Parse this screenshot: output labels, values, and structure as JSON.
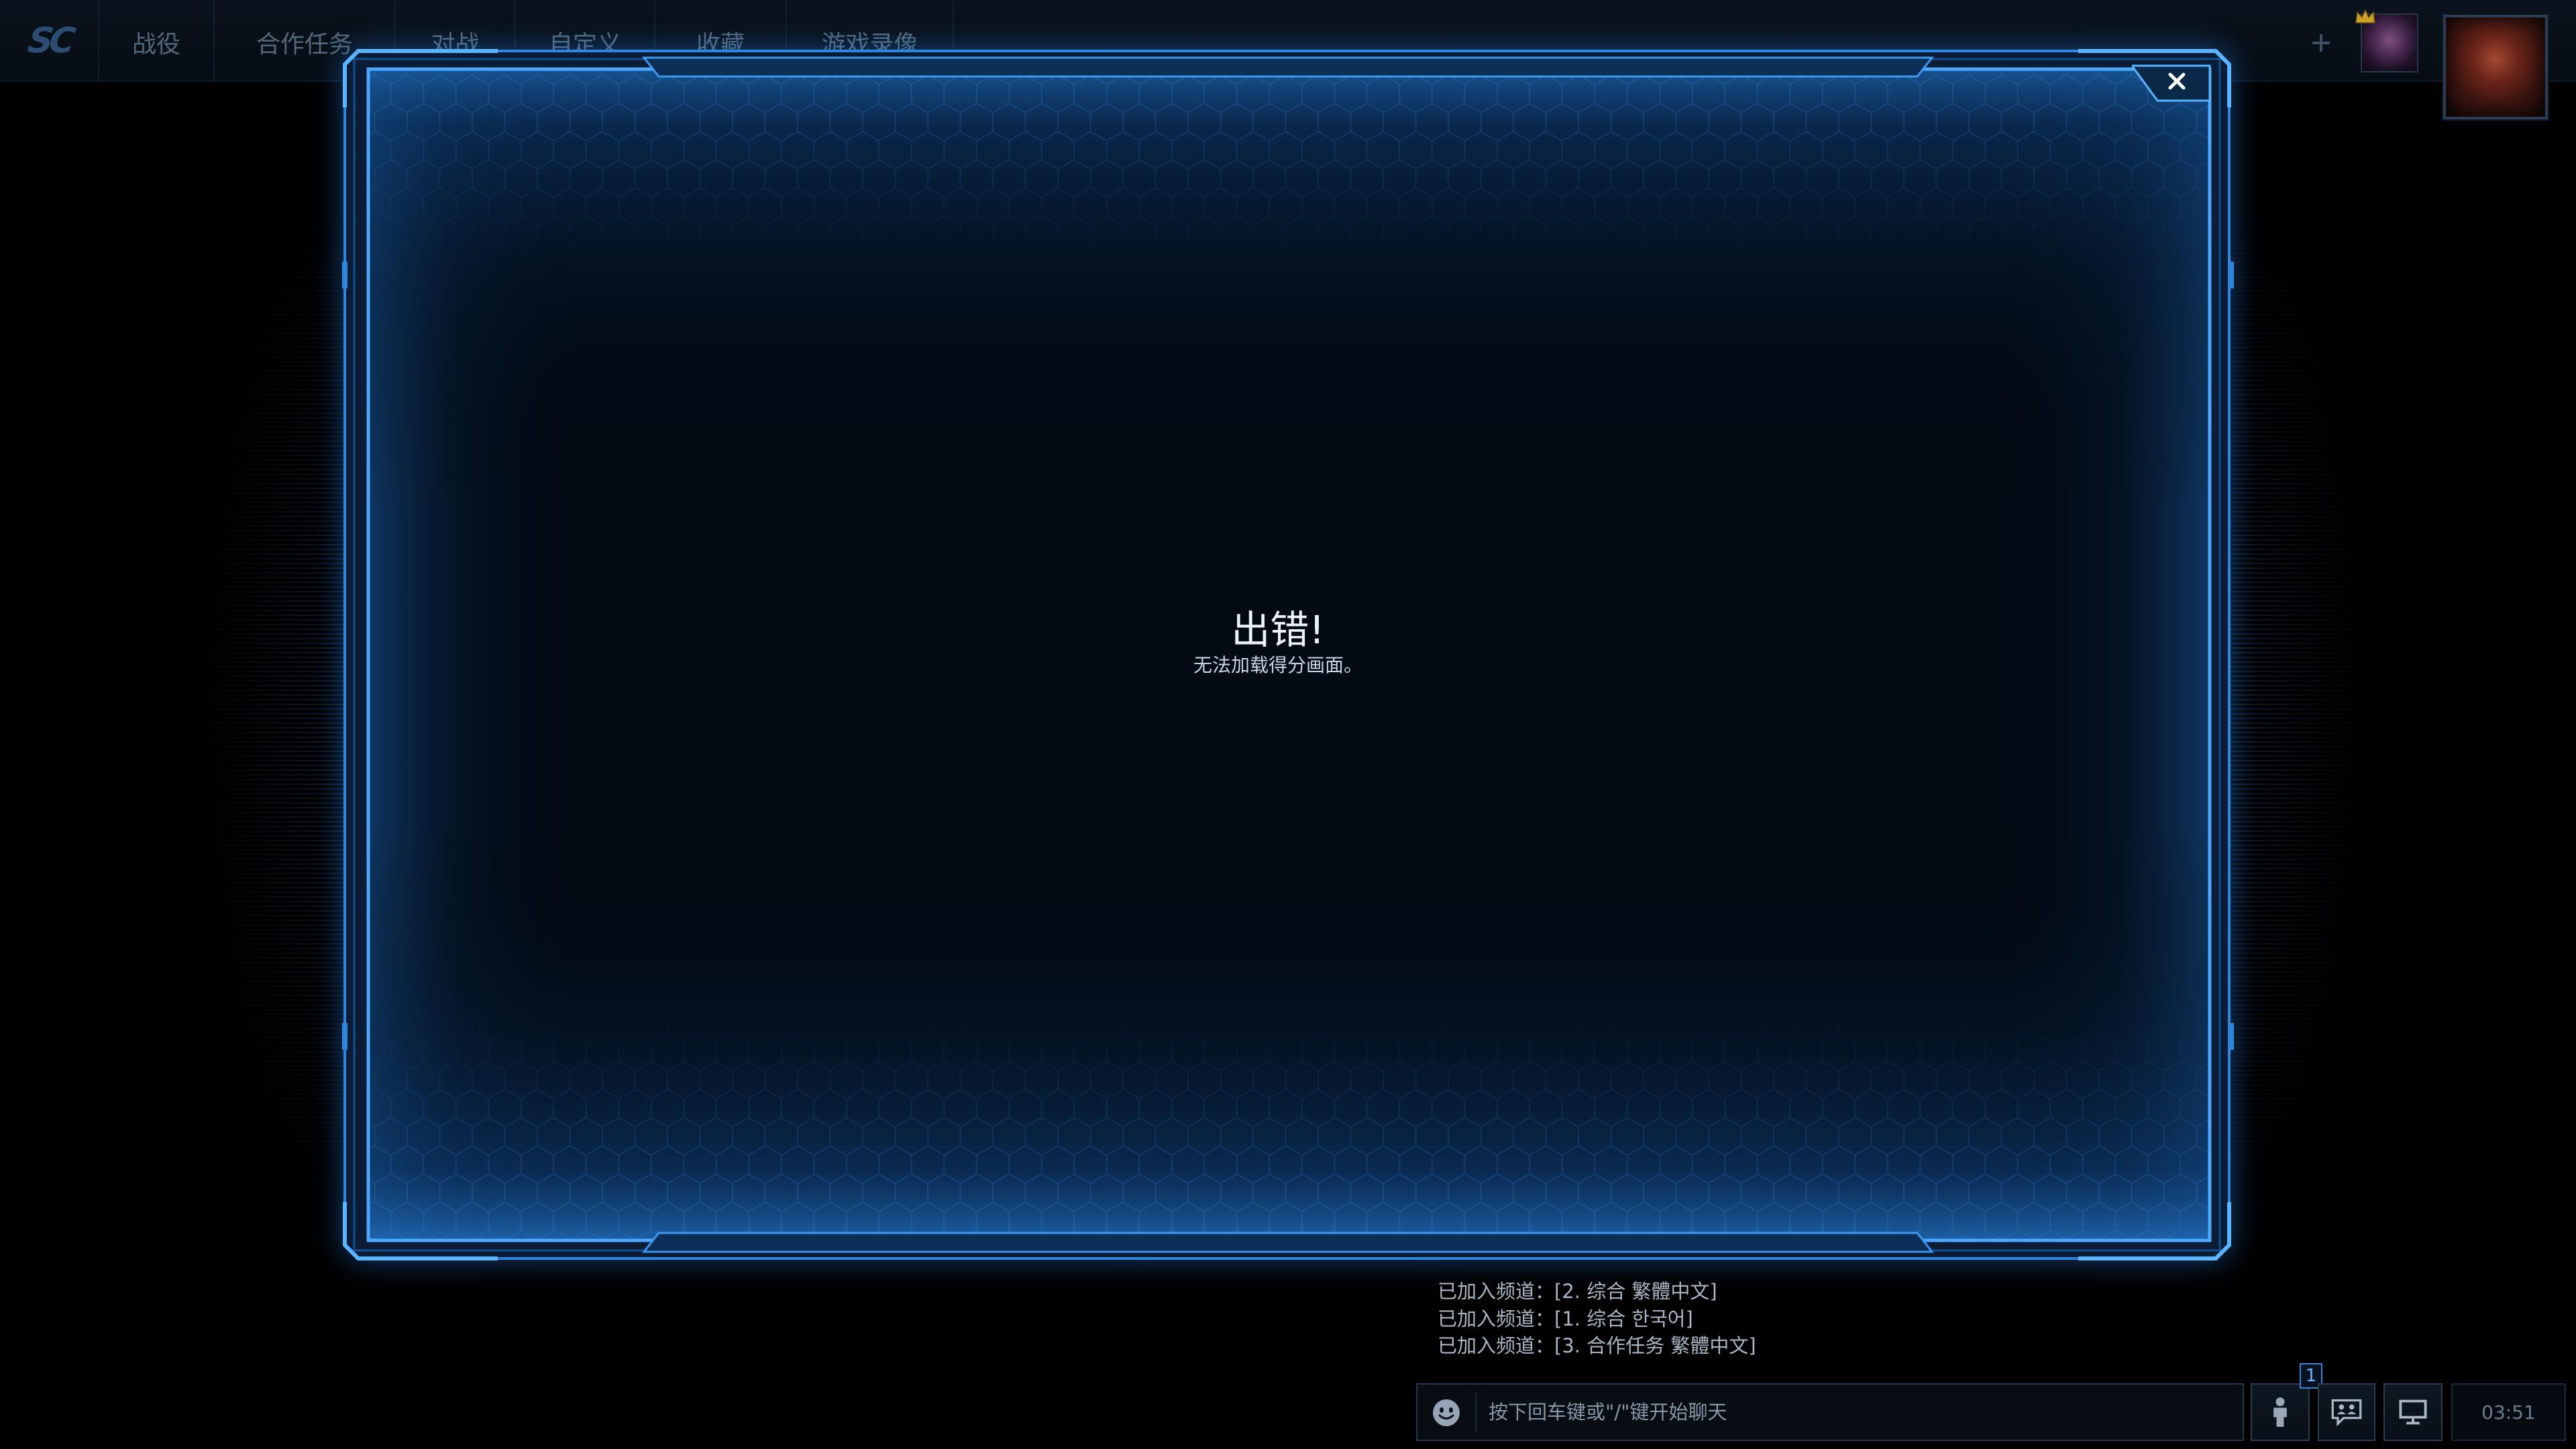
{
  "nav": {
    "logo_text": "SC",
    "items": [
      {
        "label": "战役"
      },
      {
        "label": "合作任务"
      },
      {
        "label": "对战"
      },
      {
        "label": "自定义"
      },
      {
        "label": "收藏"
      },
      {
        "label": "游戏录像"
      }
    ],
    "add_icon": "plus-icon",
    "crown_icon": "crown-icon"
  },
  "dialog": {
    "title": "出错!",
    "message": "无法加载得分画面。",
    "close_icon": "close-icon"
  },
  "chat": {
    "messages": [
      "已加入频道：[2. 综合 繁體中文]",
      "已加入频道：[1. 综合 한국어]",
      "已加入频道：[3. 合作任务 繁體中文]"
    ],
    "input_placeholder": "按下回车键或\"/\"键开始聊天",
    "emoji_icon": "smiley-icon"
  },
  "footer": {
    "friends_icon": "person-icon",
    "friends_badge": "1",
    "chat_icon": "chat-icon",
    "monitor_icon": "monitor-icon",
    "clock": "03:51"
  },
  "colors": {
    "frame_accent": "#4ca8ff",
    "panel_background": "#020a14",
    "nav_text": "#53677b",
    "chat_text": "#a9b6c4",
    "badge": "#6fb2ff"
  }
}
